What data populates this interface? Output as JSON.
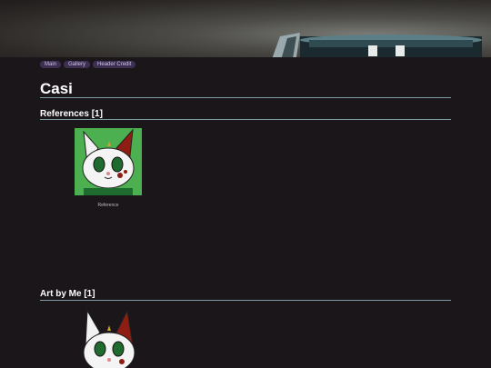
{
  "nav": {
    "items": [
      "Main",
      "Gallery",
      "Header Credit"
    ]
  },
  "profile": {
    "name": "Casi"
  },
  "sections": [
    {
      "heading": "References [1]",
      "items": [
        {
          "caption": "Reference"
        }
      ]
    },
    {
      "heading": "Art by Me [1]"
    }
  ],
  "colors": {
    "background": "#1a1619",
    "rule": "#7e9aa6",
    "pill": "#3c2f52",
    "pill_text": "#cfc2ea",
    "thumb_bg": "#4caf50"
  }
}
